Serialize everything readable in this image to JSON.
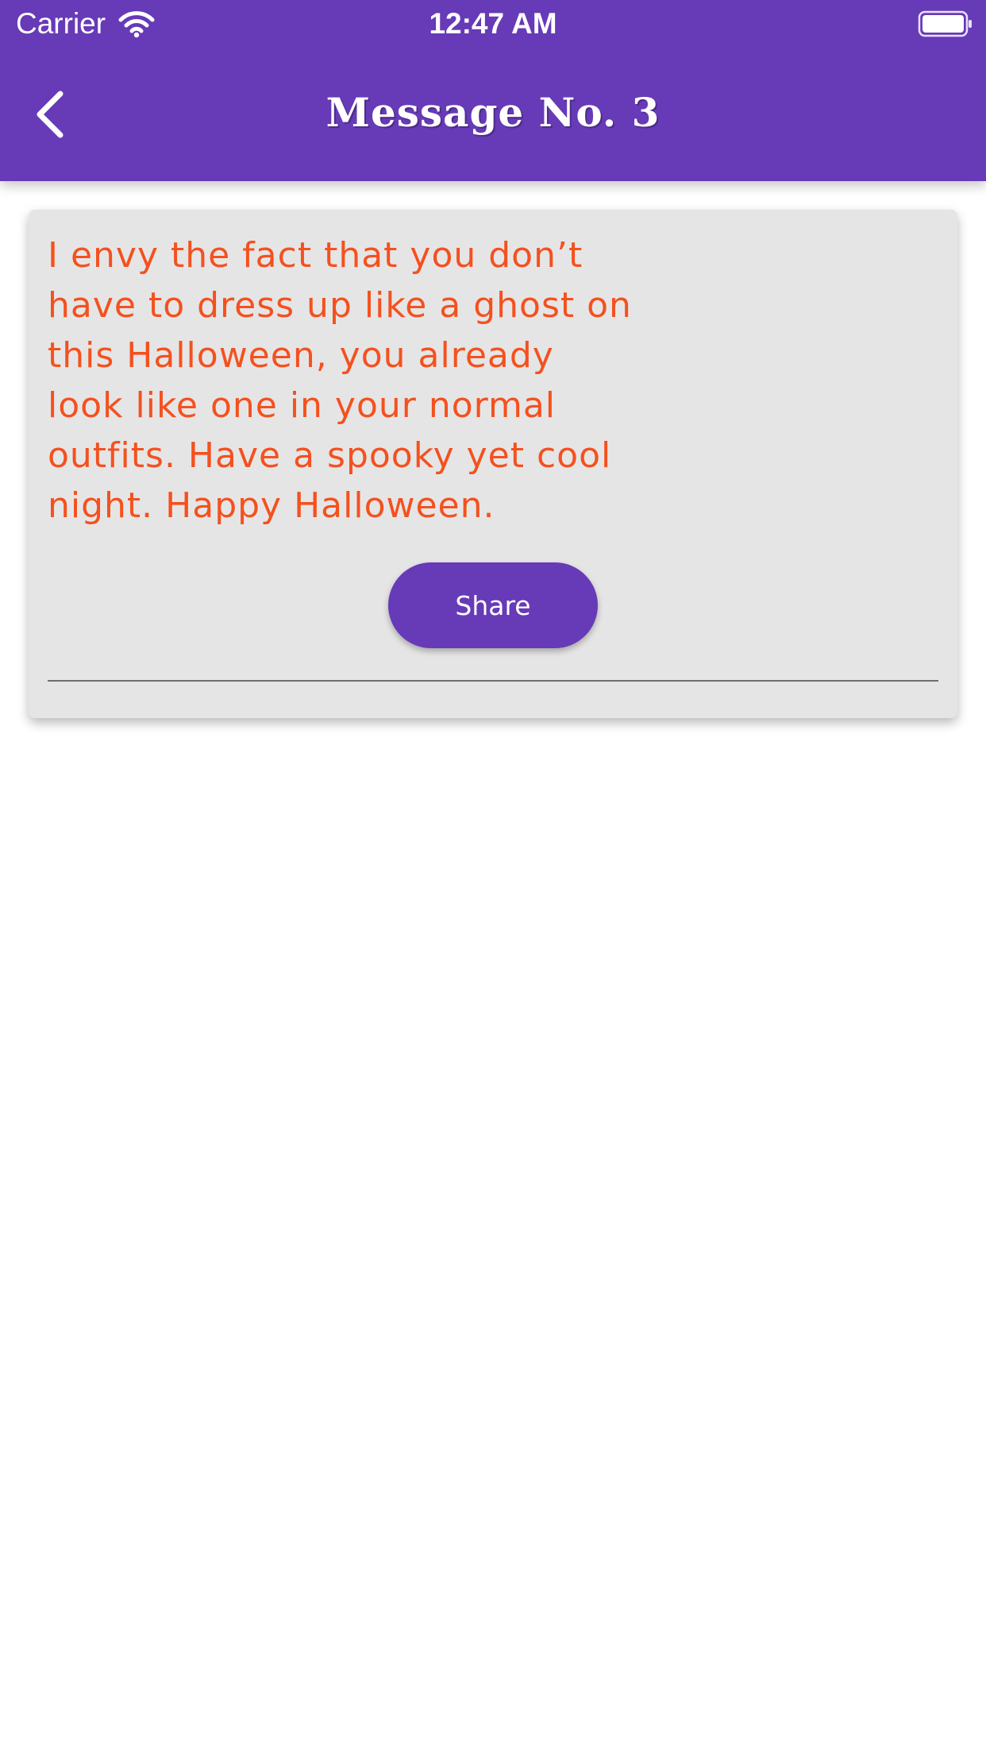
{
  "status_bar": {
    "carrier": "Carrier",
    "time": "12:47 AM",
    "wifi_icon": "wifi-icon",
    "battery_icon": "battery-full-icon"
  },
  "nav": {
    "title": "Message No. 3",
    "back_icon": "chevron-left-icon"
  },
  "message": {
    "text": "I envy the fact that you don’t have to dress up like a ghost on this Halloween, you already look like one in your normal outfits. Have a spooky yet cool night. Happy Halloween.",
    "share_label": "Share"
  },
  "colors": {
    "primary": "#673ab7",
    "message_text": "#f4511e",
    "card_background": "#e6e5e6",
    "page_background": "#ffffff"
  }
}
